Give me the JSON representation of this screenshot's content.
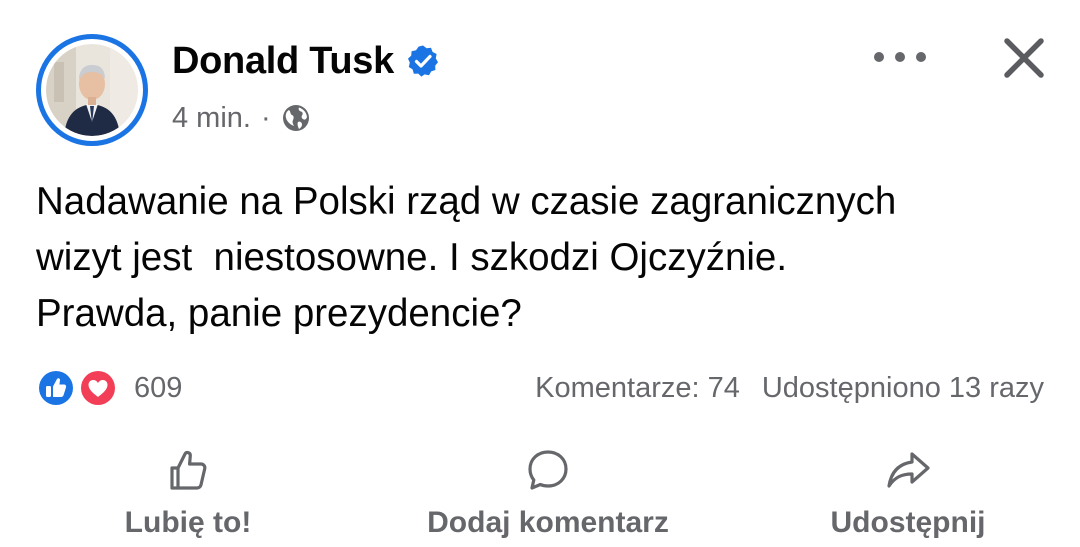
{
  "post": {
    "author": "Donald Tusk",
    "timestamp": "4 min.",
    "separator": "·",
    "text": "Nadawanie na Polski rząd w czasie zagranicznych\nwizyt jest  niestosowne. I szkodzi Ojczyźnie.\nPrawda, panie prezydencie?"
  },
  "engagement": {
    "reaction_count": "609",
    "comments": "Komentarze: 74",
    "shares": "Udostępniono 13 razy"
  },
  "actions": {
    "like_label": "Lubię to!",
    "comment_label": "Dodaj komentarz",
    "share_label": "Udostępnij"
  },
  "icons": {
    "verified": "verified-badge-icon",
    "audience": "globe-icon",
    "more": "more-options-icon",
    "close": "close-icon",
    "like_reaction": "like-reaction-icon",
    "love_reaction": "love-reaction-icon",
    "like_action": "thumbs-up-icon",
    "comment_action": "comment-bubble-icon",
    "share_action": "share-arrow-icon"
  },
  "colors": {
    "accent": "#1b74e4",
    "text_primary": "#050505",
    "text_secondary": "#65676b",
    "love": "#f33e58"
  }
}
